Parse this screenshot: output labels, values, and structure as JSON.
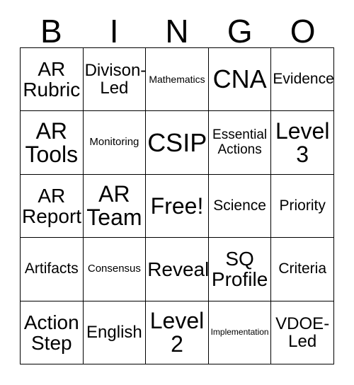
{
  "card": {
    "header_letters": [
      "B",
      "I",
      "N",
      "G",
      "O"
    ],
    "colors": {
      "background": "#ffffff",
      "border": "#000000",
      "text": "#000000"
    },
    "rows": [
      [
        {
          "label": "AR\nRubric",
          "size": "xl"
        },
        {
          "label": "Divison-\nLed",
          "size": "l"
        },
        {
          "label": "Mathematics",
          "size": "s"
        },
        {
          "label": "CNA",
          "size": "huge"
        },
        {
          "label": "Evidence",
          "size": "ml"
        }
      ],
      [
        {
          "label": "AR\nTools",
          "size": "xxl"
        },
        {
          "label": "Monitoring",
          "size": "sm"
        },
        {
          "label": "CSIP",
          "size": "huge"
        },
        {
          "label": "Essential\nActions",
          "size": "m"
        },
        {
          "label": "Level\n3",
          "size": "xxl"
        }
      ],
      [
        {
          "label": "AR\nReport",
          "size": "xl"
        },
        {
          "label": "AR\nTeam",
          "size": "xxl"
        },
        {
          "label": "Free!",
          "size": "xxl"
        },
        {
          "label": "Science",
          "size": "ml"
        },
        {
          "label": "Priority",
          "size": "ml"
        }
      ],
      [
        {
          "label": "Artifacts",
          "size": "ml"
        },
        {
          "label": "Consensus",
          "size": "sm"
        },
        {
          "label": "Reveal",
          "size": "xl"
        },
        {
          "label": "SQ\nProfile",
          "size": "xl"
        },
        {
          "label": "Criteria",
          "size": "ml"
        }
      ],
      [
        {
          "label": "Action\nStep",
          "size": "xl"
        },
        {
          "label": "English",
          "size": "l"
        },
        {
          "label": "Level\n2",
          "size": "xxl"
        },
        {
          "label": "Implementation",
          "size": "xs"
        },
        {
          "label": "VDOE-\nLed",
          "size": "l"
        }
      ]
    ]
  }
}
